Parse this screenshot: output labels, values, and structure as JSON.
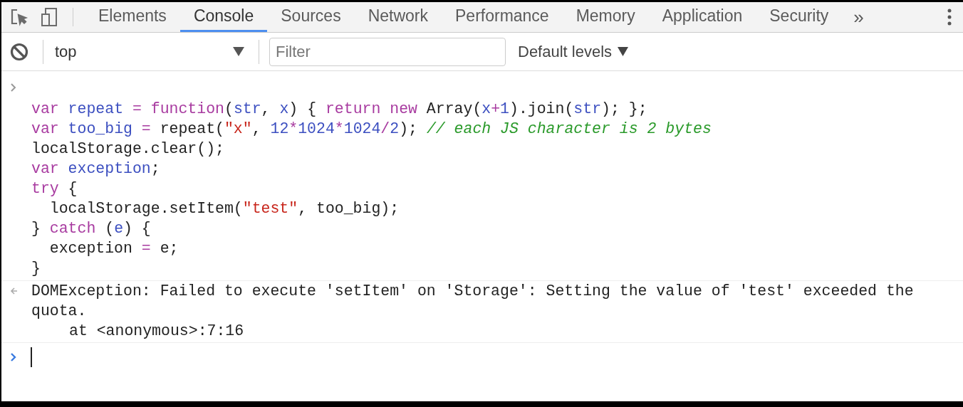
{
  "tabs": [
    {
      "label": "Elements",
      "selected": false
    },
    {
      "label": "Console",
      "selected": true
    },
    {
      "label": "Sources",
      "selected": false
    },
    {
      "label": "Network",
      "selected": false
    },
    {
      "label": "Performance",
      "selected": false
    },
    {
      "label": "Memory",
      "selected": false
    },
    {
      "label": "Application",
      "selected": false
    },
    {
      "label": "Security",
      "selected": false
    }
  ],
  "more_tabs": "»",
  "toolbar": {
    "context": "top",
    "filter": {
      "placeholder": "Filter"
    },
    "levels": "Default levels"
  },
  "console": {
    "input_code": [
      [
        {
          "kind": "keyword",
          "text": "var"
        },
        {
          "kind": "variable",
          "text": " repeat"
        },
        {
          "kind": "keyword",
          "text": " ="
        },
        {
          "kind": "keyword",
          "text": " function"
        },
        {
          "kind": "plain",
          "text": "("
        },
        {
          "kind": "variable",
          "text": "str"
        },
        {
          "kind": "plain",
          "text": ", "
        },
        {
          "kind": "variable",
          "text": "x"
        },
        {
          "kind": "plain",
          "text": ") { "
        },
        {
          "kind": "keyword",
          "text": "return"
        },
        {
          "kind": "keyword",
          "text": " new"
        },
        {
          "kind": "plain",
          "text": " Array("
        },
        {
          "kind": "variable",
          "text": "x"
        },
        {
          "kind": "keyword",
          "text": "+"
        },
        {
          "kind": "number",
          "text": "1"
        },
        {
          "kind": "plain",
          "text": ").join("
        },
        {
          "kind": "variable",
          "text": "str"
        },
        {
          "kind": "plain",
          "text": "); };"
        }
      ],
      [
        {
          "kind": "keyword",
          "text": "var"
        },
        {
          "kind": "variable",
          "text": " too_big"
        },
        {
          "kind": "keyword",
          "text": " ="
        },
        {
          "kind": "plain",
          "text": " repeat("
        },
        {
          "kind": "string",
          "text": "\"x\""
        },
        {
          "kind": "plain",
          "text": ", "
        },
        {
          "kind": "number",
          "text": "12"
        },
        {
          "kind": "keyword",
          "text": "*"
        },
        {
          "kind": "number",
          "text": "1024"
        },
        {
          "kind": "keyword",
          "text": "*"
        },
        {
          "kind": "number",
          "text": "1024"
        },
        {
          "kind": "keyword",
          "text": "/"
        },
        {
          "kind": "number",
          "text": "2"
        },
        {
          "kind": "plain",
          "text": "); "
        },
        {
          "kind": "comment",
          "text": "// each JS character is 2 bytes"
        }
      ],
      [
        {
          "kind": "plain",
          "text": "localStorage.clear();"
        }
      ],
      [
        {
          "kind": "keyword",
          "text": "var"
        },
        {
          "kind": "variable",
          "text": " exception"
        },
        {
          "kind": "plain",
          "text": ";"
        }
      ],
      [
        {
          "kind": "keyword",
          "text": "try"
        },
        {
          "kind": "plain",
          "text": " {"
        }
      ],
      [
        {
          "kind": "plain",
          "text": "  localStorage.setItem("
        },
        {
          "kind": "string",
          "text": "\"test\""
        },
        {
          "kind": "plain",
          "text": ", too_big);"
        }
      ],
      [
        {
          "kind": "plain",
          "text": "} "
        },
        {
          "kind": "keyword",
          "text": "catch"
        },
        {
          "kind": "plain",
          "text": " ("
        },
        {
          "kind": "variable",
          "text": "e"
        },
        {
          "kind": "plain",
          "text": ") {"
        }
      ],
      [
        {
          "kind": "plain",
          "text": "  exception "
        },
        {
          "kind": "keyword",
          "text": "="
        },
        {
          "kind": "plain",
          "text": " e;"
        }
      ],
      [
        {
          "kind": "plain",
          "text": "}"
        }
      ]
    ],
    "error_message": "DOMException: Failed to execute 'setItem' on 'Storage': Setting the value of 'test' exceeded the quota.",
    "stack_trace": "at <anonymous>:7:16"
  }
}
